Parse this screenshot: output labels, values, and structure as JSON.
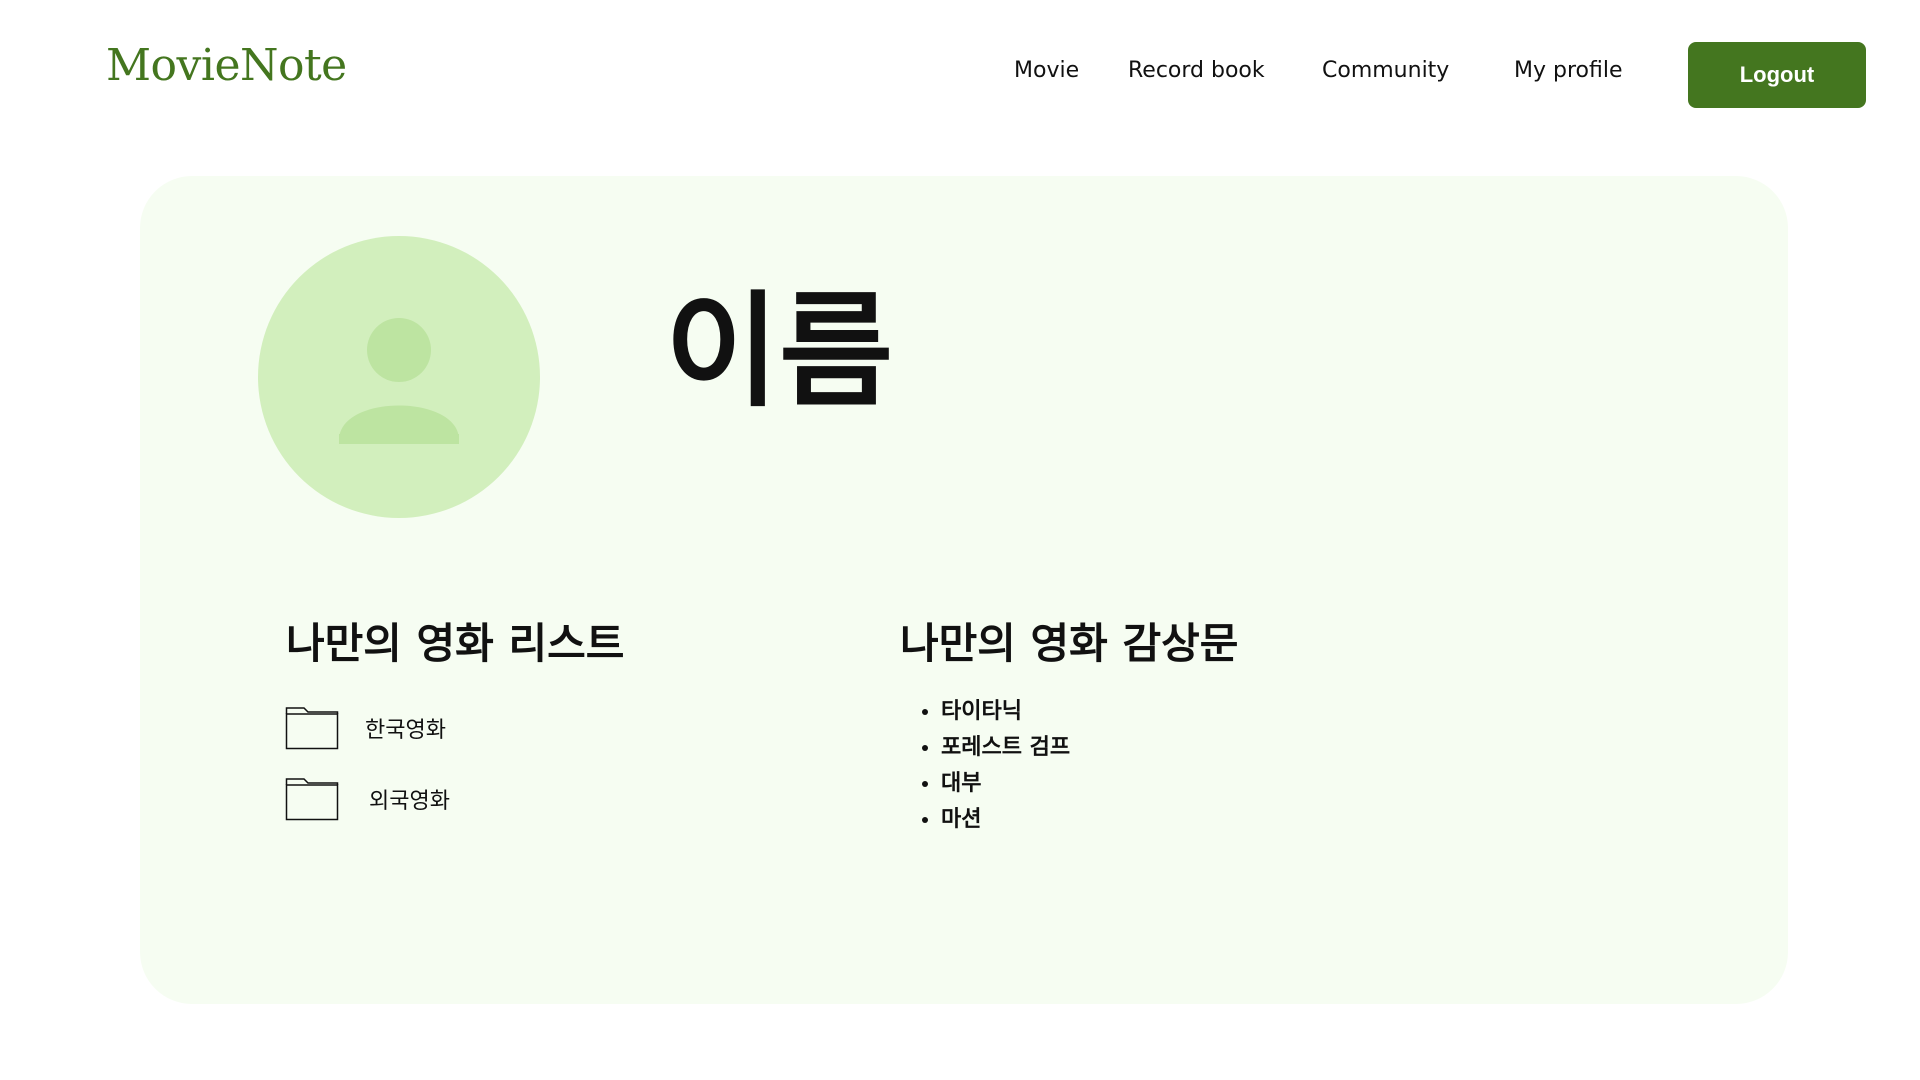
{
  "header": {
    "logo": "MovieNote",
    "nav": [
      {
        "label": "Movie"
      },
      {
        "label": "Record book"
      },
      {
        "label": "Community"
      },
      {
        "label": "My profile"
      }
    ],
    "logout_label": "Logout"
  },
  "profile": {
    "name": "이름",
    "avatar_icon": "user-silhouette-icon"
  },
  "my_list": {
    "title": "나만의 영화 리스트",
    "folders": [
      {
        "label": "한국영화",
        "icon": "folder-icon"
      },
      {
        "label": "외국영화",
        "icon": "folder-icon"
      }
    ]
  },
  "my_reviews": {
    "title": "나만의 영화 감상문",
    "items": [
      "타이타닉",
      "포레스트 검프",
      "대부",
      "마션"
    ]
  },
  "colors": {
    "brand": "#44761f",
    "card_background": "#f6fdf2",
    "avatar_background": "#d2efbd",
    "avatar_figure": "#bde4a1"
  }
}
